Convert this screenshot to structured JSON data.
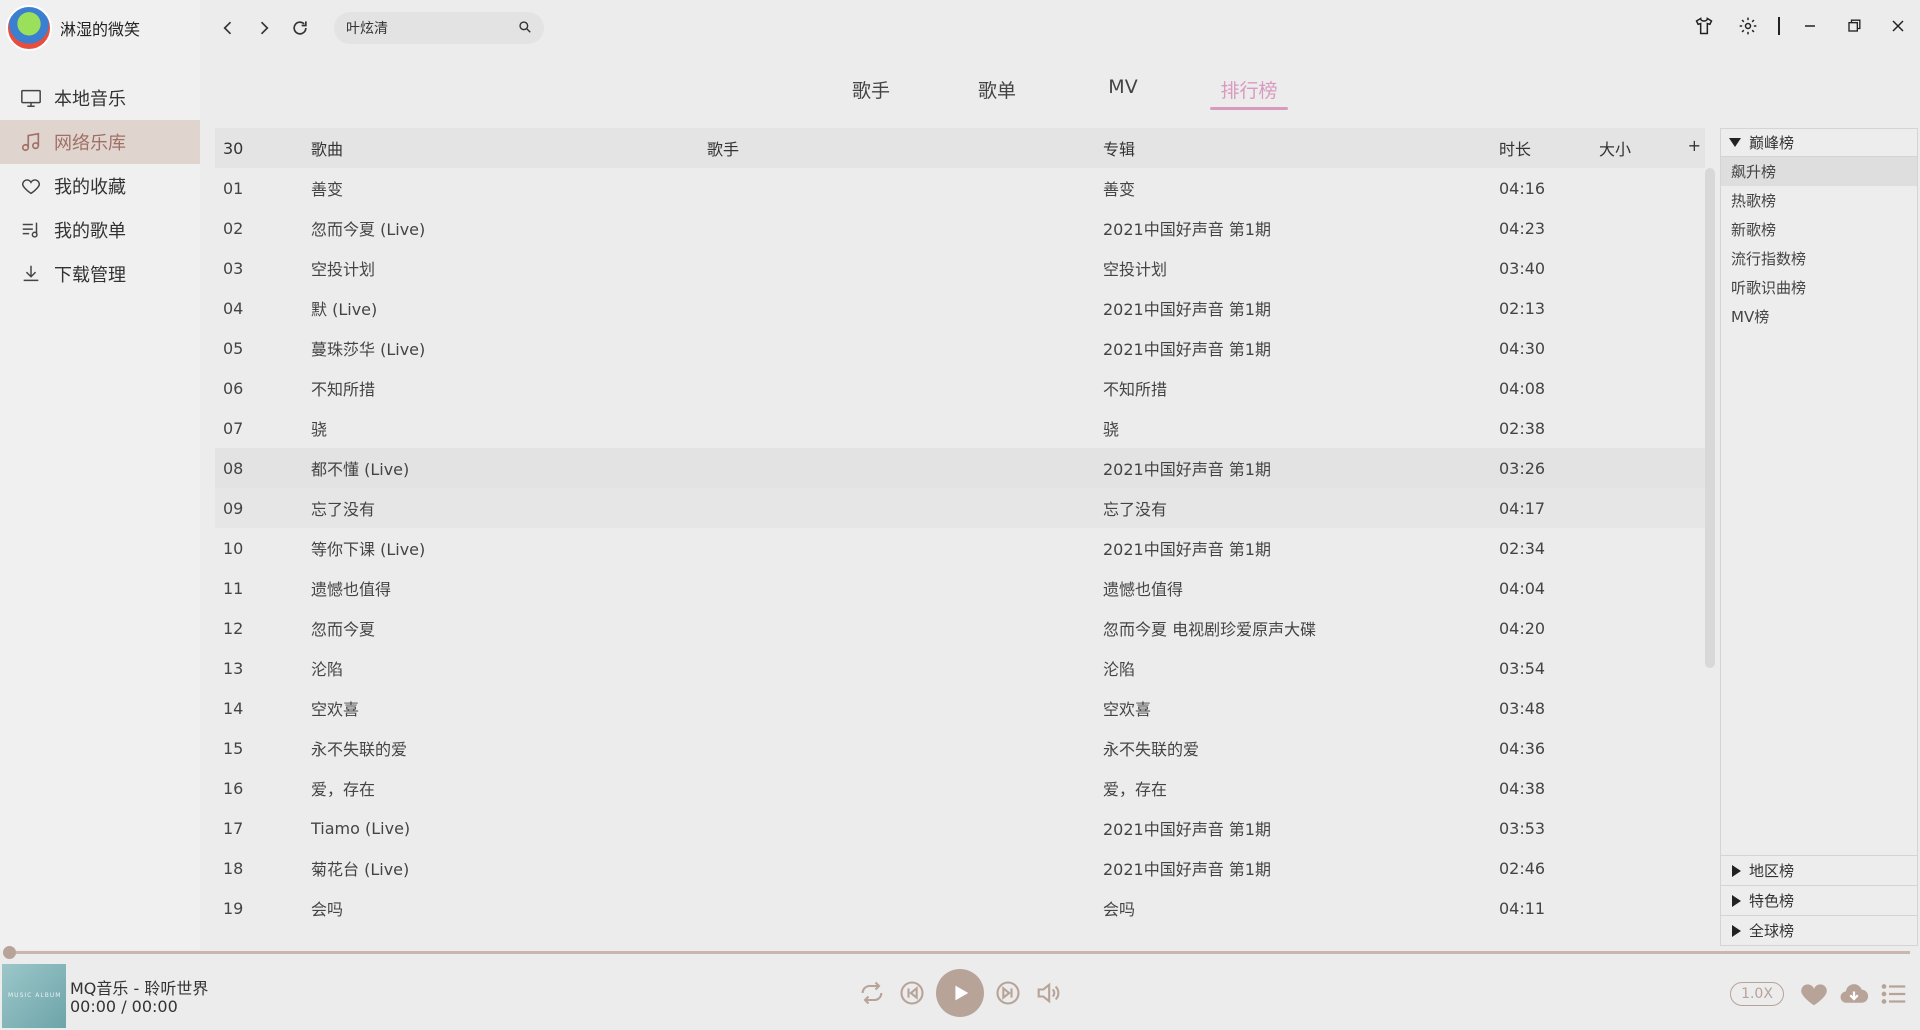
{
  "profile": {
    "name": "淋湿的微笑"
  },
  "sidebar": {
    "items": [
      {
        "label": "本地音乐",
        "icon": "monitor-icon"
      },
      {
        "label": "网络乐库",
        "icon": "music-note-icon",
        "active": true
      },
      {
        "label": "我的收藏",
        "icon": "heart-icon"
      },
      {
        "label": "我的歌单",
        "icon": "playlist-icon"
      },
      {
        "label": "下载管理",
        "icon": "download-icon"
      }
    ]
  },
  "search": {
    "value": "叶炫清"
  },
  "tabs": [
    "歌手",
    "歌单",
    "MV",
    "排行榜"
  ],
  "active_tab": "排行榜",
  "table": {
    "count": "30",
    "headers": {
      "song": "歌曲",
      "artist": "歌手",
      "album": "专辑",
      "duration": "时长",
      "size": "大小",
      "add": "+"
    },
    "rows": [
      {
        "no": "01",
        "song": "善变",
        "artist": "",
        "album": "善变",
        "duration": "04:16",
        "size": ""
      },
      {
        "no": "02",
        "song": "忽而今夏 (Live)",
        "artist": "",
        "album": "2021中国好声音 第1期",
        "duration": "04:23",
        "size": ""
      },
      {
        "no": "03",
        "song": "空投计划",
        "artist": "",
        "album": "空投计划",
        "duration": "03:40",
        "size": ""
      },
      {
        "no": "04",
        "song": "默 (Live)",
        "artist": "",
        "album": "2021中国好声音 第1期",
        "duration": "02:13",
        "size": ""
      },
      {
        "no": "05",
        "song": "蔓珠莎华 (Live)",
        "artist": "",
        "album": "2021中国好声音 第1期",
        "duration": "04:30",
        "size": ""
      },
      {
        "no": "06",
        "song": "不知所措",
        "artist": "",
        "album": "不知所措",
        "duration": "04:08",
        "size": ""
      },
      {
        "no": "07",
        "song": "骁",
        "artist": "",
        "album": "骁",
        "duration": "02:38",
        "size": ""
      },
      {
        "no": "08",
        "song": "都不懂 (Live)",
        "artist": "",
        "album": "2021中国好声音 第1期",
        "duration": "03:26",
        "size": ""
      },
      {
        "no": "09",
        "song": "忘了没有",
        "artist": "",
        "album": "忘了没有",
        "duration": "04:17",
        "size": ""
      },
      {
        "no": "10",
        "song": "等你下课 (Live)",
        "artist": "",
        "album": "2021中国好声音 第1期",
        "duration": "02:34",
        "size": ""
      },
      {
        "no": "11",
        "song": "遗憾也值得",
        "artist": "",
        "album": "遗憾也值得",
        "duration": "04:04",
        "size": ""
      },
      {
        "no": "12",
        "song": "忽而今夏",
        "artist": "",
        "album": "忽而今夏 电视剧珍爱原声大碟",
        "duration": "04:20",
        "size": ""
      },
      {
        "no": "13",
        "song": "沦陷",
        "artist": "",
        "album": "沦陷",
        "duration": "03:54",
        "size": ""
      },
      {
        "no": "14",
        "song": "空欢喜",
        "artist": "",
        "album": "空欢喜",
        "duration": "03:48",
        "size": ""
      },
      {
        "no": "15",
        "song": "永不失联的爱",
        "artist": "",
        "album": "永不失联的爱",
        "duration": "04:36",
        "size": ""
      },
      {
        "no": "16",
        "song": "爱，存在",
        "artist": "",
        "album": "爱，存在",
        "duration": "04:38",
        "size": ""
      },
      {
        "no": "17",
        "song": "Tiamo (Live)",
        "artist": "",
        "album": "2021中国好声音 第1期",
        "duration": "03:53",
        "size": ""
      },
      {
        "no": "18",
        "song": "菊花台 (Live)",
        "artist": "",
        "album": "2021中国好声音 第1期",
        "duration": "02:46",
        "size": ""
      },
      {
        "no": "19",
        "song": "会吗",
        "artist": "",
        "album": "会吗",
        "duration": "04:11",
        "size": ""
      }
    ]
  },
  "charts_panel": {
    "peak": {
      "title": "巅峰榜",
      "items": [
        "飙升榜",
        "热歌榜",
        "新歌榜",
        "流行指数榜",
        "听歌识曲榜",
        "MV榜"
      ]
    },
    "collapsed": [
      "地区榜",
      "特色榜",
      "全球榜"
    ]
  },
  "player": {
    "track": "MQ音乐 - 聆听世界",
    "time": "00:00 / 00:00",
    "speed": "1.0X",
    "progress": 0
  },
  "colors": {
    "accent": "#b8a398",
    "tab_active": "#d99ac0",
    "nav_active_bg": "#e0d4cf"
  }
}
